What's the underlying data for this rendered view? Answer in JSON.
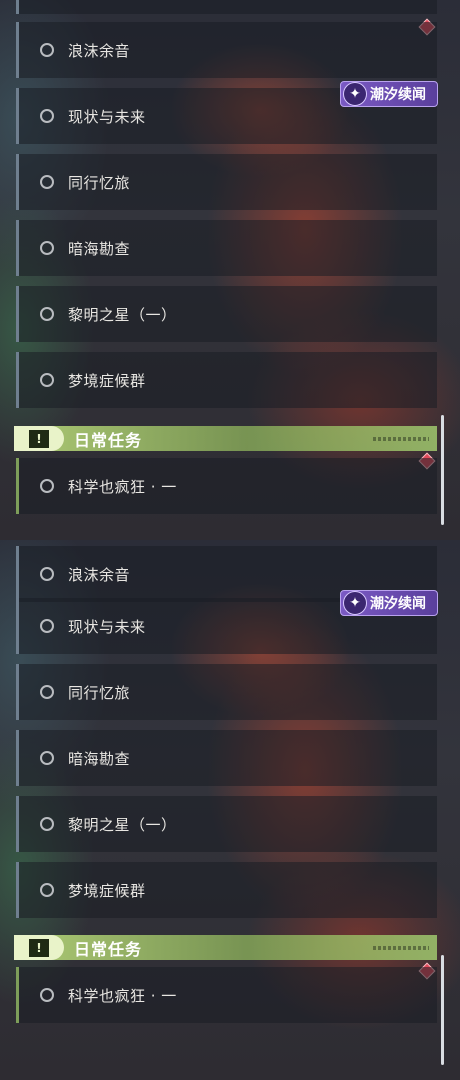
{
  "panels": [
    {
      "quests": [
        "浪沫余音",
        "现状与未来",
        "同行忆旅",
        "暗海勘查",
        "黎明之星（一）",
        "梦境症候群"
      ],
      "event_badge": "潮汐续闻",
      "daily_header": "日常任务",
      "daily_quest": "科学也疯狂 · 一"
    },
    {
      "quests": [
        "浪沫余音",
        "现状与未来",
        "同行忆旅",
        "暗海勘查",
        "黎明之星（一）",
        "梦境症候群"
      ],
      "event_badge": "潮汐续闻",
      "daily_header": "日常任务",
      "daily_quest": "科学也疯狂 · 一"
    }
  ],
  "icons": {
    "quest_status": "circle-outline-icon",
    "event_badge": "sparkle-icon",
    "daily_header": "exclamation-box-icon",
    "new_marker": "diamond-icon"
  },
  "colors": {
    "event_badge": "#6a4cb4",
    "daily_header": "#a8c97a",
    "new_marker": "#e04a5a"
  }
}
